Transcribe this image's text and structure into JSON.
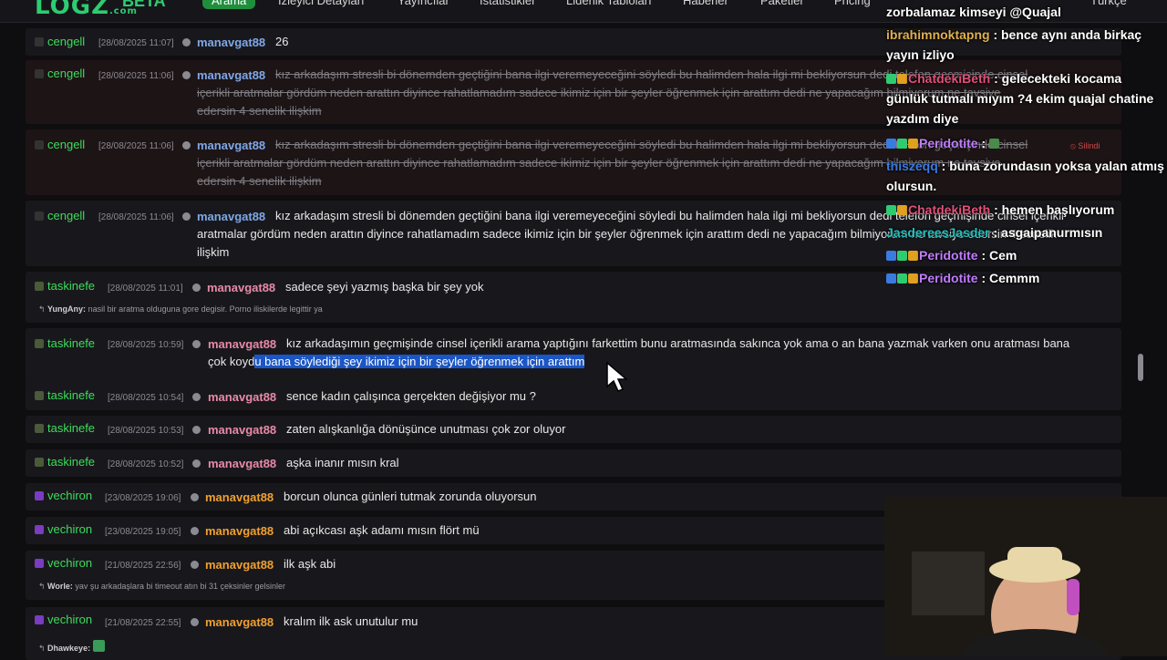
{
  "header": {
    "logo": "LOGZ",
    "logo_suffix": ".com",
    "beta": "BETA",
    "nav": [
      {
        "label": "Arama",
        "active": true
      },
      {
        "label": "İzleyici Detayları"
      },
      {
        "label": "Yayıncılar"
      },
      {
        "label": "İstatistikler"
      },
      {
        "label": "Liderlik Tabloları"
      },
      {
        "label": "Haberler"
      },
      {
        "label": "Paketler"
      },
      {
        "label": "Pricing"
      }
    ],
    "language": "Türkçe"
  },
  "rows": [
    {
      "channel": "cengell",
      "time": "[28/08/2025 11:07]",
      "user": "manavgat88",
      "message": "26"
    },
    {
      "channel": "cengell",
      "time": "[28/08/2025 11:06]",
      "user": "manavgat88",
      "message_l1": "kız arkadaşım stresli bi dönemden geçtiğini bana ilgi veremeyeceğini söyledi bu halimden hala ilgi mi bekliyorsun dedi telefon geçmişinde cinsel",
      "message_l2": "içerikli aratmalar gördüm neden arattın diyince rahatlamadım sadece ikimiz için bir şeyler öğrenmek için arattım dedi ne yapacağım bilmiyorum ne tavsiye",
      "message_l3": "edersin 4 senelik ilişkim"
    },
    {
      "channel": "cengell",
      "time": "[28/08/2025 11:06]",
      "user": "manavgat88",
      "message_l1": "kız arkadaşım stresli bi dönemden geçtiğini bana ilgi veremeyeceğini söyledi bu halimden hala ilgi mi bekliyorsun dedi telefon geçmişinde cinsel",
      "message_l2": "içerikli aratmalar gördüm neden arattın diyince rahatlamadım sadece ikimiz için bir şeyler öğrenmek için arattım dedi ne yapacağım bilmiyorum ne tavsiye",
      "message_l3": "edersin 4 senelik ilişkim",
      "deleted_badge": "Silindi"
    },
    {
      "channel": "cengell",
      "time": "[28/08/2025 11:06]",
      "user": "manavgat88",
      "message_l1": "kız arkadaşım stresli bi dönemden geçtiğini bana ilgi veremeyeceğini söyledi bu halimden hala ilgi mi bekliyorsun dedi telefon geçmişinde cinsel içerikli",
      "message_l2": "aratmalar gördüm neden arattın diyince rahatlamadım sadece ikimiz için bir şeyler öğrenmek için arattım dedi ne yapacağım bilmiyorum ne tavsiye edersin 4 senelik",
      "message_l3": "ilişkim"
    },
    {
      "channel": "taskinefe",
      "time": "[28/08/2025 11:01]",
      "user": "manavgat88",
      "message": "sadece şeyi yazmış başka bir şey yok",
      "reply_user": "YungAny:",
      "reply_text": "nasil bir aratma olduguna gore degisir. Porno iliskilerde legittir ya"
    },
    {
      "channel": "taskinefe",
      "time": "[28/08/2025 10:59]",
      "user": "manavgat88",
      "message_l1": "kız arkadaşımın geçmişinde cinsel içerikli arama yaptığını farkettim bunu aratmasında sakınca yok ama o an bana yazmak varken onu aratması bana",
      "message_l2_plain": "çok koyd",
      "message_l2_hl": "u bana söylediği şey ikimiz için bir şeyler öğrenmek için arattım"
    },
    {
      "channel": "taskinefe",
      "time": "[28/08/2025 10:54]",
      "user": "manavgat88",
      "message": "sence kadın çalışınca gerçekten değişiyor mu ?"
    },
    {
      "channel": "taskinefe",
      "time": "[28/08/2025 10:53]",
      "user": "manavgat88",
      "message": "zaten alışkanlığa dönüşünce unutması çok zor oluyor"
    },
    {
      "channel": "taskinefe",
      "time": "[28/08/2025 10:52]",
      "user": "manavgat88",
      "message": "aşka inanır mısın kral"
    },
    {
      "channel": "vechiron",
      "time": "[23/08/2025 19:06]",
      "user": "manavgat88",
      "message": "borcun olunca günleri tutmak zorunda oluyorsun"
    },
    {
      "channel": "vechiron",
      "time": "[23/08/2025 19:05]",
      "user": "manavgat88",
      "message": "abi açıkcası aşk adamı mısın flört mü"
    },
    {
      "channel": "vechiron",
      "time": "[21/08/2025 22:56]",
      "user": "manavgat88",
      "message": "ilk aşk abi",
      "reply_user": "Worle:",
      "reply_text": "yav şu arkadaşlara bi timeout atın bi 31 çeksinler gelsinler"
    },
    {
      "channel": "vechiron",
      "time": "[21/08/2025 22:55]",
      "user": "manavgat88",
      "message": "kralım ilk ask unutulur mu",
      "reply_user": "Dhawkeye:",
      "reply_text": ""
    }
  ],
  "chat": [
    {
      "user": "",
      "text": "zorbalamaz kimseyi @Quajal",
      "color": "#ffffff"
    },
    {
      "user": "ibrahimnoktapng",
      "text": ": bence aynı anda birkaç yayın izliyo",
      "color": "#e0b050"
    },
    {
      "user": "ChatdekiBeth",
      "text": ": gelecekteki kocama günlük tutmalı mıyım ?4 ekim quajal chatine yazdım diye",
      "color": "#e0507a"
    },
    {
      "user": "Peridotite",
      "text": ":",
      "color": "#c07cff"
    },
    {
      "user": "thiszeqq",
      "text": ": buna zorundasın yoksa yalan atmış olursun.",
      "color": "#3a7be0"
    },
    {
      "user": "ChatdekiBeth",
      "text": ": hemen başlıyorum",
      "color": "#e0507a"
    },
    {
      "user": "JasdereesJasder",
      "text": ": asgaipanurmısın",
      "color": "#20c0c0"
    },
    {
      "user": "Peridotite",
      "text": ": Cem",
      "color": "#c07cff"
    },
    {
      "user": "Peridotite",
      "text": ": Cemmm",
      "color": "#c07cff"
    }
  ],
  "colors": {
    "accent": "#2ecc71",
    "channel": "#3ddc5b",
    "target_a": "#7fa8e8",
    "target_b": "#e88aa8",
    "target_c": "#f0a030",
    "highlight": "#1a56c6"
  }
}
